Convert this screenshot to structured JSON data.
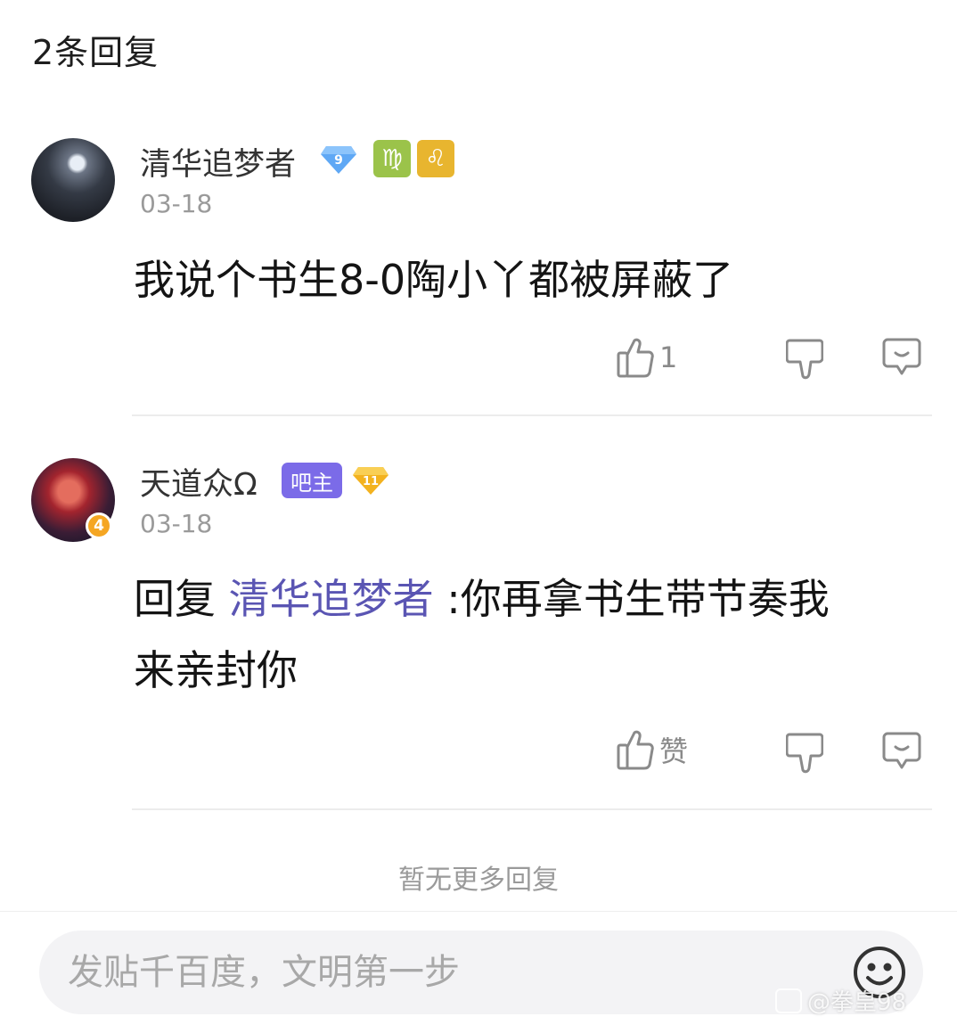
{
  "header": {
    "title": "2条回复"
  },
  "comments": [
    {
      "username": "清华追梦者",
      "level": "9",
      "zodiac_1": "♍",
      "zodiac_2": "♌",
      "time": "03-18",
      "content": "我说个书生8-0陶小丫都被屏蔽了",
      "like_count": "1"
    },
    {
      "username": "天道众Ω",
      "role_badge": "吧主",
      "level": "11",
      "avatar_badge": "4",
      "time": "03-18",
      "reply_prefix": "回复",
      "reply_to": "清华追梦者",
      "content_line1": ":你再拿书生带节奏我",
      "content_line2": "来亲封你",
      "like_label": "赞"
    }
  ],
  "footer": {
    "no_more": "暂无更多回复",
    "input_placeholder": "发贴千百度，文明第一步",
    "watermark": "@拳皇98"
  },
  "colors": {
    "mention": "#5a55b3",
    "bazhu_badge": "#7b6be8",
    "zodiac_green": "#9bc34a",
    "zodiac_yellow": "#e8b52f"
  }
}
